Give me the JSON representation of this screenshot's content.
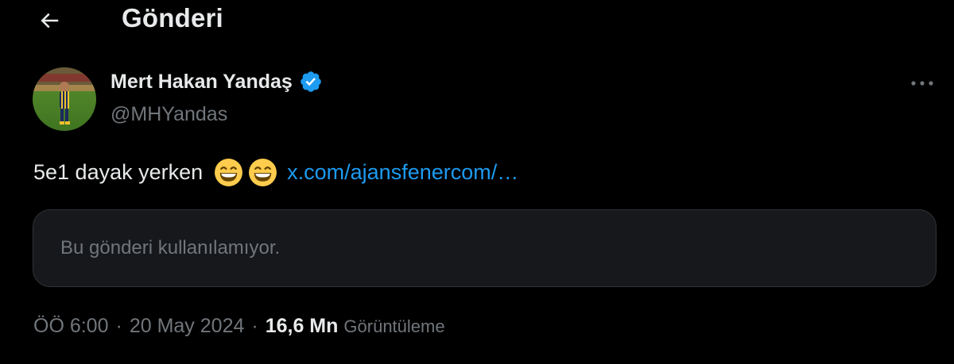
{
  "colors": {
    "background": "#000000",
    "text_primary": "#e7e9ea",
    "text_secondary": "#71767b",
    "link": "#1d9bf0",
    "verified": "#1d9bf0",
    "card_background": "#16181c",
    "card_border": "#2f3336"
  },
  "header": {
    "back_icon": "arrow-left-icon",
    "title": "Gönderi"
  },
  "tweet": {
    "author": {
      "name": "Mert Hakan Yandaş",
      "handle": "@MHYandas",
      "verified_icon": "verified-badge-icon",
      "avatar_icon": "profile-photo"
    },
    "more_icon": "more-horizontal-icon",
    "text": "5e1 dayak yerken",
    "emojis": [
      "grinning-face-with-smiling-eyes-emoji",
      "grinning-face-with-smiling-eyes-emoji"
    ],
    "link": "x.com/ajansfenercom/…",
    "quoted_unavailable": "Bu gönderi kullanılamıyor.",
    "time": "ÖÖ 6:00",
    "separator": "·",
    "date": "20 May 2024",
    "views_count": "16,6 Mn",
    "views_label": "Görüntüleme"
  }
}
